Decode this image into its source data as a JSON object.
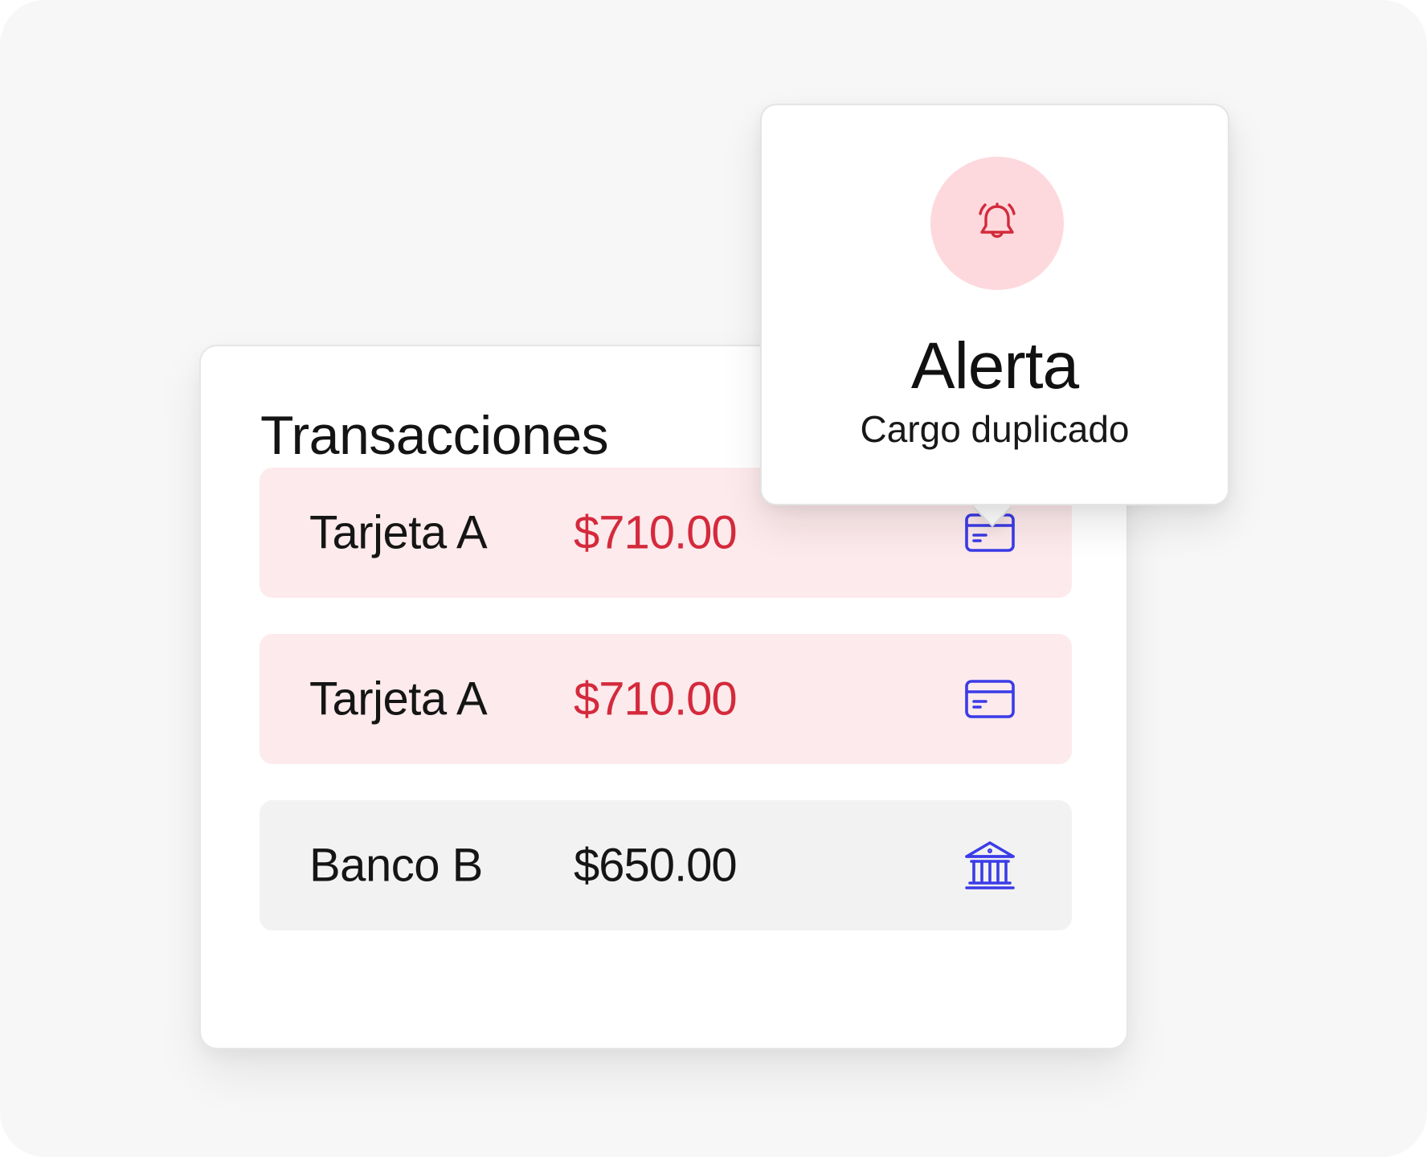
{
  "transactions": {
    "title": "Transacciones",
    "rows": [
      {
        "name": "Tarjeta A",
        "amount": "$710.00",
        "status": "duplicate",
        "icon": "credit-card-icon"
      },
      {
        "name": "Tarjeta A",
        "amount": "$710.00",
        "status": "duplicate",
        "icon": "credit-card-icon"
      },
      {
        "name": "Banco B",
        "amount": "$650.00",
        "status": "normal",
        "icon": "bank-icon"
      }
    ]
  },
  "alert": {
    "icon": "bell-icon",
    "title": "Alerta",
    "message": "Cargo duplicado"
  },
  "colors": {
    "alert_red": "#d42a3c",
    "alert_row_bg": "#fdeaec",
    "alert_circle_bg": "#fdd9dd",
    "icon_blue": "#3b3be8",
    "normal_row_bg": "#f2f2f2",
    "background": "#f7f7f7"
  }
}
